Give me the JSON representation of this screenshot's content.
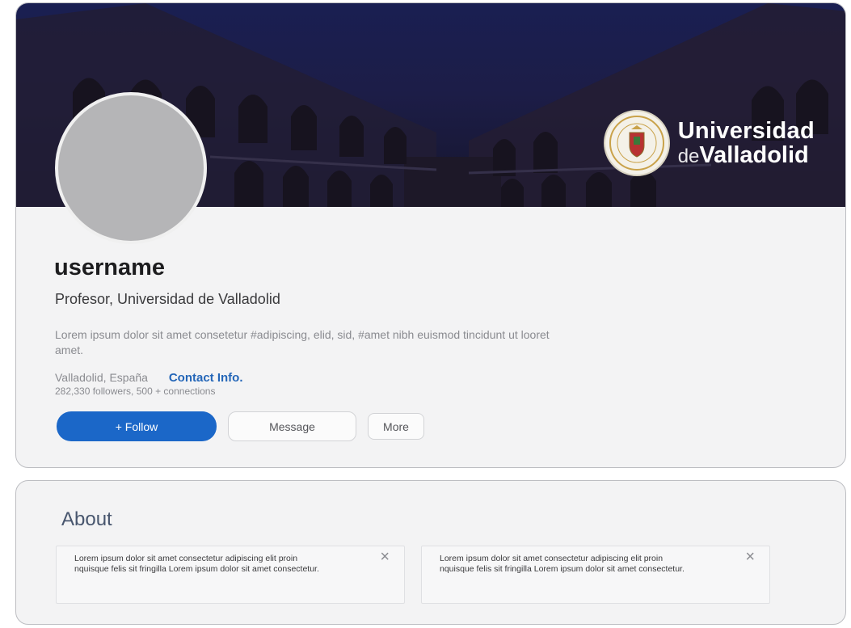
{
  "profile": {
    "banner": {
      "logo_line1": "Universidad",
      "logo_line2_small": "de",
      "logo_line2_big": "Valladolid"
    },
    "username": "username",
    "headline": "Profesor, Universidad de Valladolid",
    "bio": "Lorem ipsum dolor sit amet consetetur #adipiscing, elid, sid, #amet nibh euismod tincidunt ut looret amet.",
    "location": "Valladolid, España",
    "contact_label": "Contact Info.",
    "stats": "282,330 followers, 500 + connections",
    "buttons": {
      "follow": "+ Follow",
      "message": "Message",
      "more": "More"
    }
  },
  "about": {
    "title": "About",
    "items": [
      {
        "text": "Lorem ipsum dolor sit amet consectetur adipiscing elit proin nquisque felis sit fringilla Lorem ipsum dolor sit amet consectetur.",
        "close": "×"
      },
      {
        "text": "Lorem ipsum dolor sit amet consectetur adipiscing elit proin nquisque felis sit fringilla Lorem ipsum dolor sit amet consectetur.",
        "close": "×"
      }
    ]
  },
  "colors": {
    "banner": "#1a1f52",
    "follow_button": "#1b67c8",
    "contact_link": "#2466b8",
    "card_background": "#f3f3f4"
  },
  "icons": {
    "seal": "university-seal-icon",
    "close": "close-icon"
  }
}
